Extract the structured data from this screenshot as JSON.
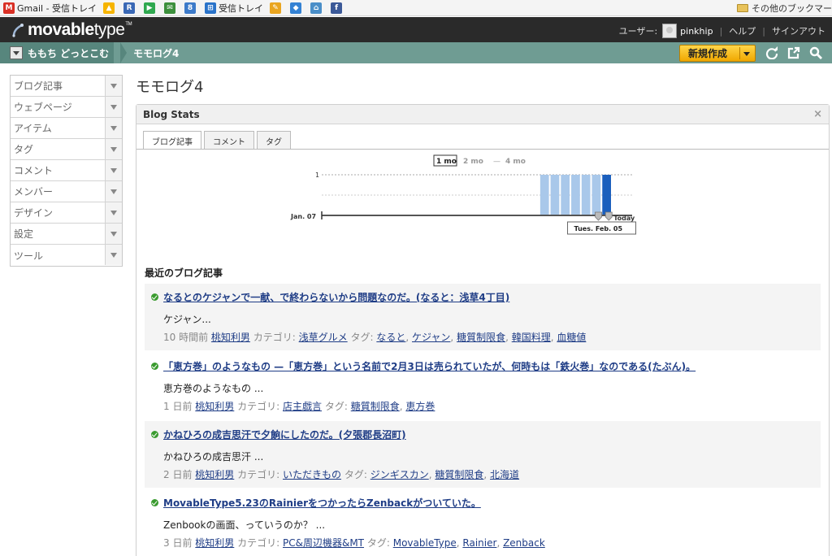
{
  "bookmarks": {
    "items": [
      {
        "label": "Gmail - 受信トレイ",
        "icon": "gmail-icon",
        "color": "#d93025",
        "glyph": "M"
      },
      {
        "label": "",
        "icon": "drive-icon",
        "color": "#f6b400",
        "glyph": "▲"
      },
      {
        "label": "",
        "icon": "sheets-icon",
        "color": "#3a68b5",
        "glyph": "R"
      },
      {
        "label": "",
        "icon": "play-icon",
        "color": "#2fa84f",
        "glyph": "▶"
      },
      {
        "label": "",
        "icon": "app-icon",
        "color": "#3c8f3c",
        "glyph": "✉"
      },
      {
        "label": "",
        "icon": "google-icon",
        "color": "#3c7ac9",
        "glyph": "8"
      },
      {
        "label": "受信トレイ",
        "icon": "windows-icon",
        "color": "#2a73c9",
        "glyph": "⊞"
      },
      {
        "label": "",
        "icon": "notes-icon",
        "color": "#e9a520",
        "glyph": "✎"
      },
      {
        "label": "",
        "icon": "dropbox-icon",
        "color": "#3482d4",
        "glyph": "◆"
      },
      {
        "label": "",
        "icon": "app2-icon",
        "color": "#4a8ec8",
        "glyph": "⌂"
      },
      {
        "label": "",
        "icon": "facebook-icon",
        "color": "#3b5998",
        "glyph": "f"
      }
    ],
    "other_folder": "その他のブックマー"
  },
  "header": {
    "logo_main": "movable",
    "logo_sub": "type",
    "logo_tm": "TM",
    "user_label": "ユーザー:",
    "username": "pinkhip",
    "help": "ヘルプ",
    "signout": "サインアウト"
  },
  "blogbar": {
    "blog_name": "ももち どっとこむ",
    "current": "モモログ4",
    "new_button": "新規作成"
  },
  "sidebar": {
    "items": [
      {
        "label": "ブログ記事"
      },
      {
        "label": "ウェブページ"
      },
      {
        "label": "アイテム"
      },
      {
        "label": "タグ"
      },
      {
        "label": "コメント"
      },
      {
        "label": "メンバー"
      },
      {
        "label": "デザイン"
      },
      {
        "label": "設定"
      },
      {
        "label": "ツール"
      }
    ]
  },
  "main": {
    "page_title": "モモログ4",
    "widget_title": "Blog Stats",
    "close_glyph": "×",
    "tabs": [
      {
        "label": "ブログ記事"
      },
      {
        "label": "コメント"
      },
      {
        "label": "タグ"
      }
    ],
    "recent_heading": "最近のブログ記事"
  },
  "chart_data": {
    "type": "bar",
    "range_options": [
      "1 mo",
      "2 mo",
      "4 mo"
    ],
    "range_selected": "1 mo",
    "range_separator": "—",
    "y_tick": "1",
    "start_label": "Jan. 07",
    "end_label": "Today",
    "marker_label": "Tues. Feb. 05",
    "ylim": [
      0,
      1
    ],
    "bars_total_days": 30,
    "bars": [
      {
        "day_index": 23,
        "value": 1
      },
      {
        "day_index": 24,
        "value": 1
      },
      {
        "day_index": 25,
        "value": 1
      },
      {
        "day_index": 26,
        "value": 1
      },
      {
        "day_index": 27,
        "value": 1
      },
      {
        "day_index": 28,
        "value": 1
      },
      {
        "day_index": 29,
        "value": 1,
        "highlight": true
      }
    ],
    "colors": {
      "bar": "#a9c8ea",
      "highlight": "#1b5fbd"
    }
  },
  "entries": [
    {
      "title": "なるとのケジャンで一献、で終わらないから問題なのだ。(なると：浅草4丁目)",
      "excerpt": "ケジャン...",
      "time": "10 時間前",
      "author": "桃知利男",
      "category_label": "カテゴリ:",
      "category": "浅草グルメ",
      "tags_label": "タグ:",
      "tags": [
        "なると",
        "ケジャン",
        "糖質制限食",
        "韓国料理",
        "血糖値"
      ]
    },
    {
      "title": "「恵方巻」のようなもの —「恵方巻」という名前で2月3日は売られていたが、何時もは「鉄火巻」なのである(たぶん)。",
      "excerpt": "恵方巻のようなもの ...",
      "time": "1 日前",
      "author": "桃知利男",
      "category_label": "カテゴリ:",
      "category": "店主戯言",
      "tags_label": "タグ:",
      "tags": [
        "糖質制限食",
        "恵方巻"
      ]
    },
    {
      "title": "かねひろの成吉思汗で夕餉にしたのだ。(夕張郡長沼町)",
      "excerpt": "かねひろの成吉思汗 ...",
      "time": "2 日前",
      "author": "桃知利男",
      "category_label": "カテゴリ:",
      "category": "いただきもの",
      "tags_label": "タグ:",
      "tags": [
        "ジンギスカン",
        "糖質制限食",
        "北海道"
      ]
    },
    {
      "title": "MovableType5.23のRainierをつかったらZenbackがついていた。",
      "excerpt": "Zenbookの画面、っていうのか？ ...",
      "time": "3 日前",
      "author": "桃知利男",
      "category_label": "カテゴリ:",
      "category": "PC&周辺機器&MT",
      "tags_label": "タグ:",
      "tags": [
        "MovableType",
        "Rainier",
        "Zenback"
      ]
    }
  ]
}
